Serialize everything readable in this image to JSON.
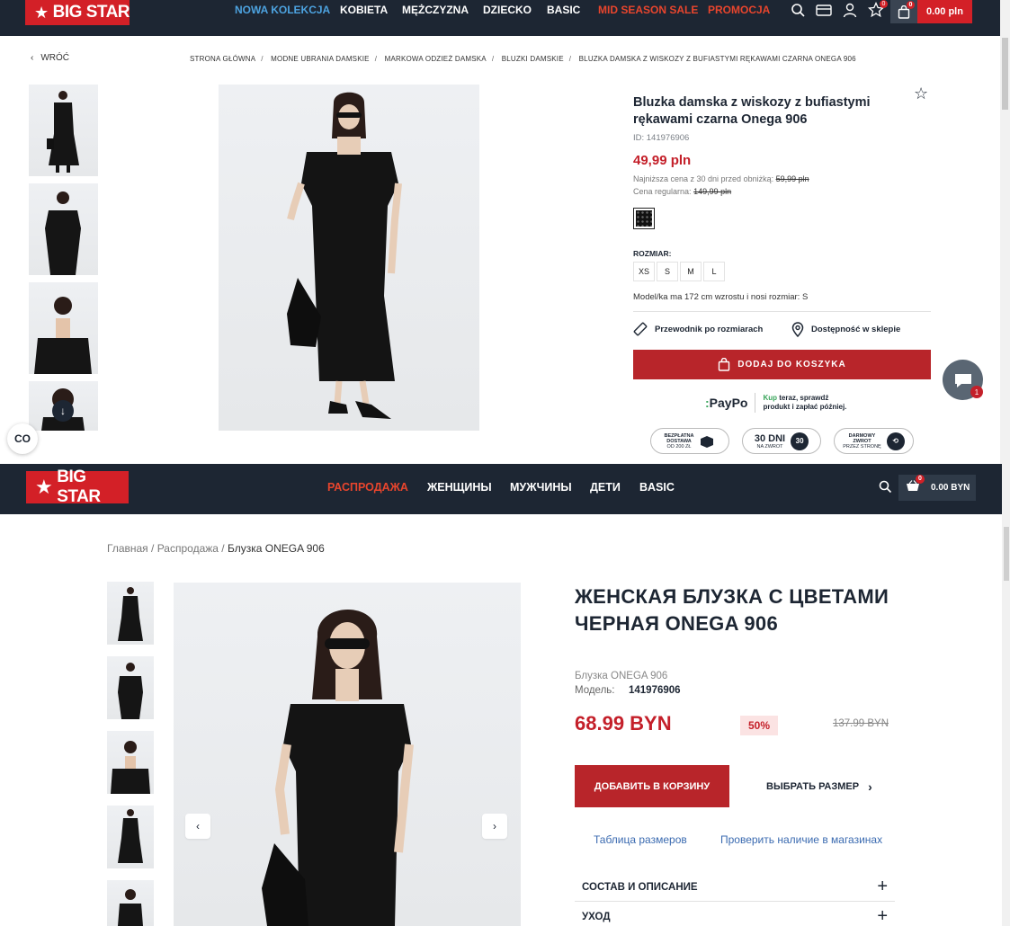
{
  "pl": {
    "logo": "BIG STAR",
    "nav": [
      {
        "label": "NOWA KOLEKCJA",
        "color": "#4da3e0"
      },
      {
        "label": "KOBIETA",
        "color": "#ffffff"
      },
      {
        "label": "MĘŻCZYZNA",
        "color": "#ffffff"
      },
      {
        "label": "DZIECKO",
        "color": "#ffffff"
      },
      {
        "label": "BASIC",
        "color": "#ffffff"
      },
      {
        "label": "MID SEASON SALE",
        "color": "#e8452d"
      },
      {
        "label": "PROMOCJA",
        "color": "#e8452d"
      }
    ],
    "cart_amount": "0.00 pln",
    "cart_badge": "0",
    "wish_badge": "0",
    "back": "WRÓĆ",
    "breadcrumbs": [
      "STRONA GŁÓWNA",
      "MODNE UBRANIA DAMSKIE",
      "MARKOWA ODZIEŻ DAMSKA",
      "BLUZKI DAMSKIE",
      "BLUZKA DAMSKA Z WISKOZY Z BUFIASTYMI RĘKAWAMI CZARNA ONEGA 906"
    ],
    "title": "Bluzka damska z wiskozy z bufiastymi rękawami czarna Onega 906",
    "id": "ID: 141976906",
    "price": "49,99 pln",
    "lowest_label": "Najniższa cena z 30 dni przed obniżką:",
    "lowest_value": "59,99 pln",
    "regular_label": "Cena regularna:",
    "regular_value": "149,99 pln",
    "size_label": "ROZMIAR:",
    "sizes": [
      "XS",
      "S",
      "M",
      "L"
    ],
    "model_info": "Model/ka ma 172 cm wzrostu i nosi rozmiar: S",
    "size_guide": "Przewodnik po rozmiarach",
    "availability": "Dostępność w sklepie",
    "add_to_cart": "DODAJ DO KOSZYKA",
    "paypo_logo": "PayPo",
    "paypo_line1_green": "Kup",
    "paypo_line1": " teraz, sprawdź",
    "paypo_line2": "produkt i zapłać później.",
    "badge1_line1": "BEZPŁATNA",
    "badge1_line2": "DOSTAWA",
    "badge1_line3": "OD 200 ZŁ",
    "badge2_main": "30 DNI",
    "badge2_sub": "NA ZWROT",
    "badge2_circle": "30",
    "badge3_line1": "DARMOWY",
    "badge3_line2": "ZWROT",
    "badge3_line3": "PRZEZ STRONĘ",
    "chat_badge": "1",
    "compare_icon": "CO"
  },
  "ru": {
    "logo": "BIG STAR",
    "nav": [
      {
        "label": "РАСПРОДАЖА",
        "color": "#e8452d"
      },
      {
        "label": "ЖЕНЩИНЫ",
        "color": "#ffffff"
      },
      {
        "label": "МУЖЧИНЫ",
        "color": "#ffffff"
      },
      {
        "label": "ДЕТИ",
        "color": "#ffffff"
      },
      {
        "label": "BASIC",
        "color": "#ffffff"
      }
    ],
    "cart_amount": "0.00 BYN",
    "cart_badge": "0",
    "breadcrumbs": [
      "Главная",
      "Распродажа",
      "Блузка ONEGA 906"
    ],
    "title": "ЖЕНСКАЯ БЛУЗКА С ЦВЕТАМИ ЧЕРНАЯ ONEGA 906",
    "subtitle": "Блузка ONEGA 906",
    "model_label": "Модель:",
    "model_value": "141976906",
    "price": "68.99 BYN",
    "discount": "50%",
    "old_price": "137.99 BYN",
    "add_to_cart": "ДОБАВИТЬ В КОРЗИНУ",
    "choose_size": "ВЫБРАТЬ РАЗМЕР",
    "size_table": "Таблица размеров",
    "check_stores": "Проверить наличие в магазинах",
    "accordions": [
      "СОСТАВ И ОПИСАНИЕ",
      "УХОД"
    ]
  }
}
